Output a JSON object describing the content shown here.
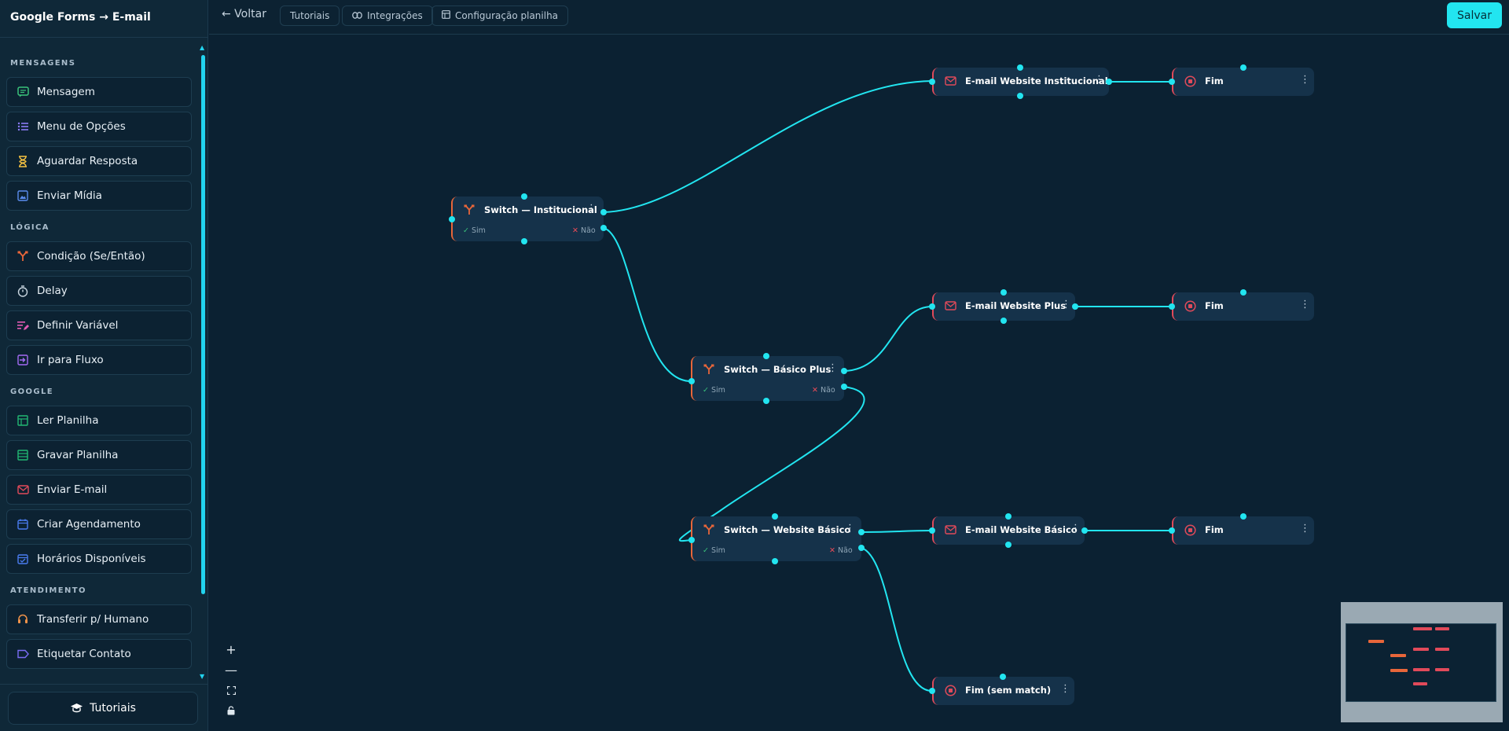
{
  "app": {
    "title": "Google Forms → E-mail"
  },
  "topbar": {
    "back_label": "← Voltar",
    "buttons": [
      {
        "label": "Tutoriais",
        "icon": "none"
      },
      {
        "label": "Integrações",
        "icon": "link-icon"
      },
      {
        "label": "Configuração planilha",
        "icon": "table-icon"
      }
    ],
    "save_label": "Salvar"
  },
  "sidebar": {
    "sections": [
      {
        "label": "MENSAGENS",
        "items": [
          {
            "label": "Mensagem",
            "icon": "chat-icon",
            "color": "#3ac27a"
          },
          {
            "label": "Menu de Opções",
            "icon": "list-icon",
            "color": "#8b7cf6"
          },
          {
            "label": "Aguardar Resposta",
            "icon": "hourglass-icon",
            "color": "#f5c242"
          },
          {
            "label": "Enviar Mídia",
            "icon": "image-icon",
            "color": "#5b8def"
          }
        ]
      },
      {
        "label": "LÓGICA",
        "items": [
          {
            "label": "Condição (Se/Então)",
            "icon": "branch-icon",
            "color": "#e8663a"
          },
          {
            "label": "Delay",
            "icon": "timer-icon",
            "color": "#c9d6e0"
          },
          {
            "label": "Definir Variável",
            "icon": "variable-icon",
            "color": "#e25bb4"
          },
          {
            "label": "Ir para Fluxo",
            "icon": "enter-icon",
            "color": "#a46bf5"
          }
        ]
      },
      {
        "label": "GOOGLE",
        "items": [
          {
            "label": "Ler Planilha",
            "icon": "sheet-icon",
            "color": "#22b873"
          },
          {
            "label": "Gravar Planilha",
            "icon": "sheet-write-icon",
            "color": "#22b873"
          },
          {
            "label": "Enviar E-mail",
            "icon": "mail-icon",
            "color": "#e14a5a"
          },
          {
            "label": "Criar Agendamento",
            "icon": "calendar-icon",
            "color": "#4a7cf0"
          },
          {
            "label": "Horários Disponíveis",
            "icon": "calendar-check-icon",
            "color": "#4a7cf0"
          }
        ]
      },
      {
        "label": "ATENDIMENTO",
        "items": [
          {
            "label": "Transferir p/ Humano",
            "icon": "headset-icon",
            "color": "#f0934a"
          },
          {
            "label": "Etiquetar Contato",
            "icon": "tag-icon",
            "color": "#7a6cf5"
          }
        ]
      }
    ],
    "tutorials_label": "Tutoriais"
  },
  "flow": {
    "nodes": [
      {
        "id": "sw-inst",
        "kind": "switch",
        "title": "Switch — Institucional",
        "sim": "Sim",
        "nao": "Não"
      },
      {
        "id": "sw-plus",
        "kind": "switch",
        "title": "Switch — Básico Plus",
        "sim": "Sim",
        "nao": "Não"
      },
      {
        "id": "sw-basico",
        "kind": "switch",
        "title": "Switch — Website Básico",
        "sim": "Sim",
        "nao": "Não"
      },
      {
        "id": "em-inst",
        "kind": "email",
        "title": "E-mail Website Institucional"
      },
      {
        "id": "em-plus",
        "kind": "email",
        "title": "E-mail Website Plus"
      },
      {
        "id": "em-basico",
        "kind": "email",
        "title": "E-mail Website Básico"
      },
      {
        "id": "fim-1",
        "kind": "end",
        "title": "Fim"
      },
      {
        "id": "fim-2",
        "kind": "end",
        "title": "Fim"
      },
      {
        "id": "fim-3",
        "kind": "end",
        "title": "Fim"
      },
      {
        "id": "fim-nomatch",
        "kind": "end",
        "title": "Fim (sem match)"
      }
    ],
    "edge_color": "#22e5f0"
  },
  "colors": {
    "accent": "#22e5f0",
    "switch": "#e8663a",
    "email": "#e14a5a",
    "sim": "#3ac27a",
    "nao": "#e84b57"
  }
}
